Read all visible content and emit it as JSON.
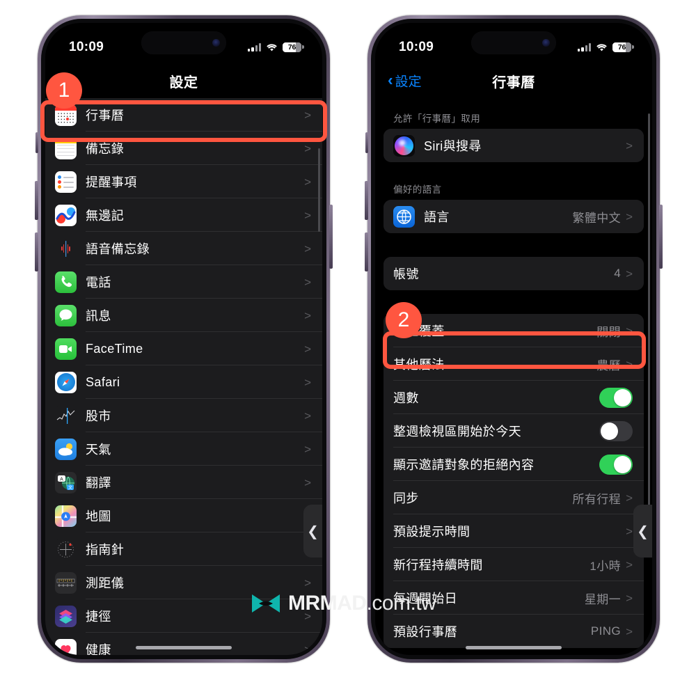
{
  "watermark": {
    "brand": "MRMAD",
    "domain": ".com.tw"
  },
  "annotations": {
    "step1": "1",
    "step2": "2"
  },
  "phones": [
    {
      "id": "left",
      "statusbar": {
        "time": "10:09",
        "battery": "76",
        "signal_icon": "cellular-signal-icon",
        "wifi_icon": "wifi-icon",
        "battery_icon": "battery-icon"
      },
      "nav": {
        "title": "設定",
        "back_label": "",
        "show_back": false
      },
      "rows": [
        {
          "label": "行事曆",
          "icon": "calendar-app-icon",
          "value": "",
          "chevron": ">",
          "highlight": true
        },
        {
          "label": "備忘錄",
          "icon": "notes-app-icon",
          "value": "",
          "chevron": ">"
        },
        {
          "label": "提醒事項",
          "icon": "reminders-app-icon",
          "value": "",
          "chevron": ">"
        },
        {
          "label": "無邊記",
          "icon": "freeform-app-icon",
          "value": "",
          "chevron": ">"
        },
        {
          "label": "語音備忘錄",
          "icon": "voice-memos-app-icon",
          "value": "",
          "chevron": ">"
        },
        {
          "label": "電話",
          "icon": "phone-app-icon",
          "value": "",
          "chevron": ">"
        },
        {
          "label": "訊息",
          "icon": "messages-app-icon",
          "value": "",
          "chevron": ">"
        },
        {
          "label": "FaceTime",
          "icon": "facetime-app-icon",
          "value": "",
          "chevron": ">"
        },
        {
          "label": "Safari",
          "icon": "safari-app-icon",
          "value": "",
          "chevron": ">"
        },
        {
          "label": "股市",
          "icon": "stocks-app-icon",
          "value": "",
          "chevron": ">"
        },
        {
          "label": "天氣",
          "icon": "weather-app-icon",
          "value": "",
          "chevron": ">"
        },
        {
          "label": "翻譯",
          "icon": "translate-app-icon",
          "value": "",
          "chevron": ">"
        },
        {
          "label": "地圖",
          "icon": "maps-app-icon",
          "value": "",
          "chevron": ">"
        },
        {
          "label": "指南針",
          "icon": "compass-app-icon",
          "value": "",
          "chevron": ">"
        },
        {
          "label": "測距儀",
          "icon": "measure-app-icon",
          "value": "",
          "chevron": ">"
        },
        {
          "label": "捷徑",
          "icon": "shortcuts-app-icon",
          "value": "",
          "chevron": ">"
        },
        {
          "label": "健康",
          "icon": "health-app-icon",
          "value": "",
          "chevron": ">"
        }
      ]
    },
    {
      "id": "right",
      "statusbar": {
        "time": "10:09",
        "battery": "76",
        "signal_icon": "cellular-signal-icon",
        "wifi_icon": "wifi-icon",
        "battery_icon": "battery-icon"
      },
      "nav": {
        "title": "行事曆",
        "back_label": "設定",
        "show_back": true
      },
      "sections": [
        {
          "header": "允許「行事曆」取用",
          "rows": [
            {
              "label": "Siri與搜尋",
              "icon": "siri-app-icon",
              "value": "",
              "chevron": ">"
            }
          ]
        },
        {
          "header": "偏好的語言",
          "rows": [
            {
              "label": "語言",
              "icon": "language-globe-icon",
              "value": "繁體中文",
              "chevron": ">"
            }
          ]
        },
        {
          "header": "",
          "rows": [
            {
              "label": "帳號",
              "icon": "",
              "value": "4",
              "chevron": ">"
            }
          ]
        },
        {
          "header": "",
          "rows": [
            {
              "label": "時區覆蓋",
              "icon": "",
              "value": "關閉",
              "chevron": ">",
              "highlight": true
            },
            {
              "label": "其他曆法",
              "icon": "",
              "value": "農曆",
              "chevron": ">"
            },
            {
              "label": "週數",
              "icon": "",
              "toggle": "on"
            },
            {
              "label": "整週檢視區開始於今天",
              "icon": "",
              "toggle": "off"
            },
            {
              "label": "顯示邀請對象的拒絕內容",
              "icon": "",
              "toggle": "on"
            },
            {
              "label": "同步",
              "icon": "",
              "value": "所有行程",
              "chevron": ">"
            },
            {
              "label": "預設提示時間",
              "icon": "",
              "value": "",
              "chevron": ">"
            },
            {
              "label": "新行程持續時間",
              "icon": "",
              "value": "1小時",
              "chevron": ">"
            },
            {
              "label": "每週開始日",
              "icon": "",
              "value": "星期一",
              "chevron": ">"
            },
            {
              "label": "預設行事曆",
              "icon": "",
              "value": "PING",
              "chevron": ">"
            }
          ]
        }
      ]
    }
  ],
  "colors": {
    "accent_highlight": "#ff5640",
    "toggle_on": "#30d158",
    "link_blue": "#0a84ff",
    "row_bg": "#1c1c1e",
    "secondary_text": "#8e8e93"
  },
  "swipe_tab_icon": "back-swipe-chevron-icon"
}
